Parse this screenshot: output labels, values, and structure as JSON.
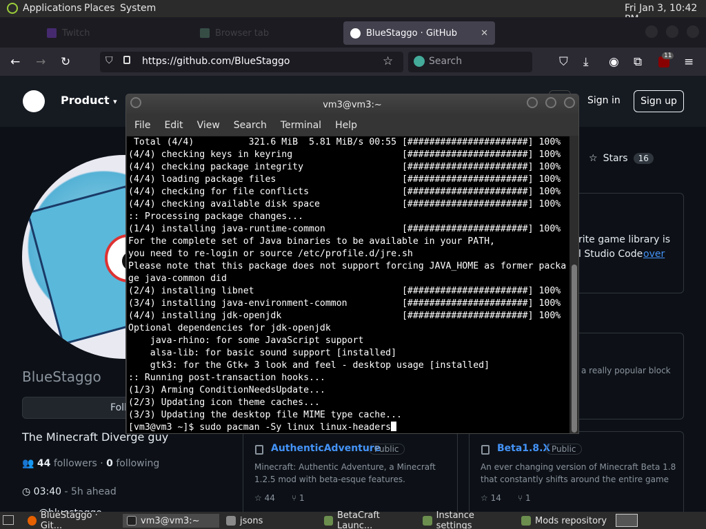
{
  "topbar": {
    "applications": "Applications",
    "places": "Places",
    "system": "System",
    "clock": "Fri Jan  3, 10:42 PM"
  },
  "browser": {
    "tabs": [
      {
        "label": "Twitch"
      },
      {
        "label": "Browser tab"
      },
      {
        "label": "BlueStaggo · GitHub"
      }
    ],
    "url": "https://github.com/BlueStaggo",
    "search_placeholder": "Search",
    "extension_badge": "11"
  },
  "github": {
    "product": "Product",
    "sign_in": "Sign in",
    "sign_up": "Sign up",
    "profile": {
      "name": "BlueStaggo",
      "follow": "Follow",
      "bio": "The Minecraft Diverge guy",
      "followers": "44",
      "followers_label": "followers",
      "dot": "·",
      "following": "0",
      "following_label": "following",
      "time": "03:40",
      "time_note": "- 5h ahead",
      "handle": "@bluestaggo"
    },
    "stars_label": "Stars",
    "stars_count": "16",
    "readme_frag1": "rite game library is",
    "readme_frag2": "l Studio Code",
    "readme_link": "over",
    "pinned_frag": "a really popular block",
    "repos": [
      {
        "title": "AuthenticAdventure",
        "badge": "Public",
        "desc": "Minecraft: Authentic Adventure, a Minecraft 1.2.5 mod with beta-esque features.",
        "stars": "44",
        "forks": "1"
      },
      {
        "title": "Beta1.8.X",
        "badge": "Public",
        "desc": "An ever changing version of Minecraft Beta 1.8 that constantly shifts around the entire game",
        "stars": "14",
        "forks": "1"
      }
    ]
  },
  "terminal": {
    "title": "vm3@vm3:~",
    "menu": [
      "File",
      "Edit",
      "View",
      "Search",
      "Terminal",
      "Help"
    ],
    "lines": [
      " Total (4/4)          321.6 MiB  5.81 MiB/s 00:55 [######################] 100%",
      "(4/4) checking keys in keyring                    [######################] 100%",
      "(4/4) checking package integrity                  [######################] 100%",
      "(4/4) loading package files                       [######################] 100%",
      "(4/4) checking for file conflicts                 [######################] 100%",
      "(4/4) checking available disk space               [######################] 100%",
      ":: Processing package changes...",
      "(1/4) installing java-runtime-common              [######################] 100%",
      "For the complete set of Java binaries to be available in your PATH,",
      "you need to re-login or source /etc/profile.d/jre.sh",
      "Please note that this package does not support forcing JAVA_HOME as former packa",
      "ge java-common did",
      "(2/4) installing libnet                           [######################] 100%",
      "(3/4) installing java-environment-common          [######################] 100%",
      "(4/4) installing jdk-openjdk                      [######################] 100%",
      "Optional dependencies for jdk-openjdk",
      "    java-rhino: for some JavaScript support",
      "    alsa-lib: for basic sound support [installed]",
      "    gtk3: for the Gtk+ 3 look and feel - desktop usage [installed]",
      ":: Running post-transaction hooks...",
      "(1/3) Arming ConditionNeedsUpdate...",
      "(2/3) Updating icon theme caches...",
      "(3/3) Updating the desktop file MIME type cache...",
      "[vm3@vm3 ~]$ sudo pacman -Sy linux linux-headers"
    ]
  },
  "taskbar": [
    {
      "label": "BlueStaggo · Git..."
    },
    {
      "label": "vm3@vm3:~"
    },
    {
      "label": "jsons"
    },
    {
      "label": "BetaCraft Launc..."
    },
    {
      "label": "Instance settings"
    },
    {
      "label": "Mods repository"
    }
  ]
}
